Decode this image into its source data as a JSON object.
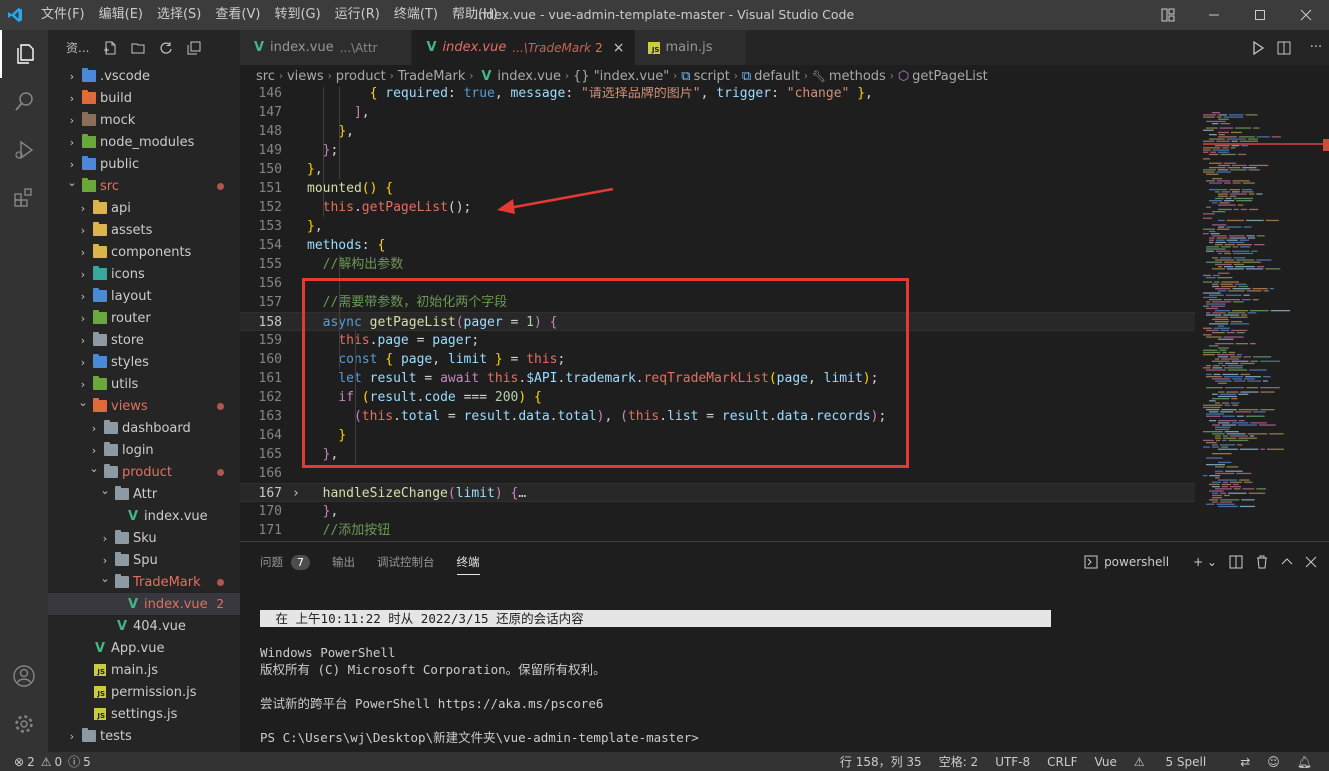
{
  "titlebar": {
    "menus": [
      "文件(F)",
      "编辑(E)",
      "选择(S)",
      "查看(V)",
      "转到(G)",
      "运行(R)",
      "终端(T)",
      "帮助(H)"
    ],
    "title": "index.vue - vue-admin-template-master - Visual Studio Code"
  },
  "sidebar": {
    "title": "资...",
    "items": [
      {
        "label": ".vscode",
        "type": "folder",
        "indent": 0,
        "chev": "›",
        "color": "#4b88d6"
      },
      {
        "label": "build",
        "type": "folder",
        "indent": 0,
        "chev": "›",
        "color": "#e06a3a"
      },
      {
        "label": "mock",
        "type": "folder",
        "indent": 0,
        "chev": "›",
        "color": "#8a7058"
      },
      {
        "label": "node_modules",
        "type": "folder",
        "indent": 0,
        "chev": "›",
        "color": "#6ba83b"
      },
      {
        "label": "public",
        "type": "folder",
        "indent": 0,
        "chev": "›",
        "color": "#4b88d6"
      },
      {
        "label": "src",
        "type": "folder",
        "indent": 0,
        "chev": "⌄",
        "color": "#6ba83b",
        "red": true,
        "dot": true
      },
      {
        "label": "api",
        "type": "folder",
        "indent": 1,
        "chev": "›",
        "color": "#dbb44a"
      },
      {
        "label": "assets",
        "type": "folder",
        "indent": 1,
        "chev": "›",
        "color": "#dbb44a"
      },
      {
        "label": "components",
        "type": "folder",
        "indent": 1,
        "chev": "›",
        "color": "#dbb44a"
      },
      {
        "label": "icons",
        "type": "folder",
        "indent": 1,
        "chev": "›",
        "color": "#38a89d"
      },
      {
        "label": "layout",
        "type": "folder",
        "indent": 1,
        "chev": "›",
        "color": "#4b88d6"
      },
      {
        "label": "router",
        "type": "folder",
        "indent": 1,
        "chev": "›",
        "color": "#6ba83b"
      },
      {
        "label": "store",
        "type": "folder",
        "indent": 1,
        "chev": "›",
        "color": "#8d9aa3"
      },
      {
        "label": "styles",
        "type": "folder",
        "indent": 1,
        "chev": "›",
        "color": "#4b88d6"
      },
      {
        "label": "utils",
        "type": "folder",
        "indent": 1,
        "chev": "›",
        "color": "#6ba83b"
      },
      {
        "label": "views",
        "type": "folder",
        "indent": 1,
        "chev": "⌄",
        "color": "#e06a3a",
        "red": true,
        "dot": true
      },
      {
        "label": "dashboard",
        "type": "folder",
        "indent": 2,
        "chev": "›",
        "color": "#8d9aa3"
      },
      {
        "label": "login",
        "type": "folder",
        "indent": 2,
        "chev": "›",
        "color": "#8d9aa3"
      },
      {
        "label": "product",
        "type": "folder",
        "indent": 2,
        "chev": "⌄",
        "color": "#8d9aa3",
        "red": true,
        "dot": true
      },
      {
        "label": "Attr",
        "type": "folder",
        "indent": 3,
        "chev": "⌄",
        "color": "#8d9aa3"
      },
      {
        "label": "index.vue",
        "type": "vue",
        "indent": 4,
        "chev": ""
      },
      {
        "label": "Sku",
        "type": "folder",
        "indent": 3,
        "chev": "›",
        "color": "#8d9aa3"
      },
      {
        "label": "Spu",
        "type": "folder",
        "indent": 3,
        "chev": "›",
        "color": "#8d9aa3"
      },
      {
        "label": "TradeMark",
        "type": "folder",
        "indent": 3,
        "chev": "⌄",
        "color": "#8d9aa3",
        "red": true,
        "dot": true
      },
      {
        "label": "index.vue",
        "type": "vue",
        "indent": 4,
        "chev": "",
        "red": true,
        "sel": true,
        "count": "2"
      },
      {
        "label": "404.vue",
        "type": "vue",
        "indent": 3,
        "chev": ""
      },
      {
        "label": "App.vue",
        "type": "vue",
        "indent": 1,
        "chev": ""
      },
      {
        "label": "main.js",
        "type": "js",
        "indent": 1,
        "chev": ""
      },
      {
        "label": "permission.js",
        "type": "js",
        "indent": 1,
        "chev": ""
      },
      {
        "label": "settings.js",
        "type": "js",
        "indent": 1,
        "chev": ""
      },
      {
        "label": "tests",
        "type": "folder",
        "indent": 0,
        "chev": "›",
        "color": "#8d9aa3"
      }
    ]
  },
  "tabs": [
    {
      "label": "index.vue",
      "desc": "...\\Attr",
      "icon": "vue",
      "active": false
    },
    {
      "label": "index.vue",
      "desc": "...\\TradeMark",
      "num": "2",
      "icon": "vue",
      "active": true
    },
    {
      "label": "main.js",
      "desc": "",
      "icon": "js",
      "active": false
    }
  ],
  "breadcrumbs": [
    "src",
    "views",
    "product",
    "TradeMark",
    "index.vue",
    "{} \"index.vue\"",
    "script",
    "default",
    "methods",
    "getPageList"
  ],
  "code": [
    {
      "ln": "146",
      "html": "        <span class='y'>{</span> <span class='v'>required</span><span class='p'>:</span> <span class='k'>true</span><span class='p'>,</span> <span class='v'>message</span><span class='p'>:</span> <span class='s'>\"请选择品牌的图片\"</span><span class='p'>,</span> <span class='v'>trigger</span><span class='p'>:</span> <span class='s'>\"change\"</span> <span class='y'>}</span><span class='p'>,</span>"
    },
    {
      "ln": "147",
      "html": "      <span class='kc'>]</span><span class='p'>,</span>"
    },
    {
      "ln": "148",
      "html": "    <span class='y'>}</span><span class='p'>,</span>"
    },
    {
      "ln": "149",
      "html": "  <span class='kc'>}</span><span class='p'>;</span>"
    },
    {
      "ln": "150",
      "html": "<span class='y'>}</span><span class='p'>,</span>"
    },
    {
      "ln": "151",
      "html": "<span class='f'>mounted</span><span class='y'>()</span> <span class='y'>{</span>"
    },
    {
      "ln": "152",
      "html": "  <span class='e'>this</span><span class='p'>.</span><span class='e'>getPageList</span><span class='p'>();</span>"
    },
    {
      "ln": "153",
      "html": "<span class='y'>}</span><span class='p'>,</span>"
    },
    {
      "ln": "154",
      "html": "<span class='v'>methods</span><span class='p'>:</span> <span class='y'>{</span>"
    },
    {
      "ln": "155",
      "html": "  <span class='c'>//解构出参数</span>"
    },
    {
      "ln": "156",
      "html": ""
    },
    {
      "ln": "157",
      "html": "  <span class='c'>//需要带参数，初始化两个字段</span>"
    },
    {
      "ln": "158",
      "html": "  <span class='k'>async</span> <span class='f'>getPageList</span><span class='kc'>(</span><span class='v'>pager</span> <span class='p'>=</span> <span class='n'>1</span><span class='kc'>)</span> <span class='kc'>{</span>",
      "cur": true
    },
    {
      "ln": "159",
      "html": "    <span class='e'>this</span><span class='p'>.</span><span class='v'>page</span> <span class='p'>=</span> <span class='v'>pager</span><span class='p'>;</span>"
    },
    {
      "ln": "160",
      "html": "    <span class='k'>const</span> <span class='y'>{</span> <span class='v'>page</span><span class='p'>,</span> <span class='v'>limit</span> <span class='y'>}</span> <span class='p'>=</span> <span class='e'>this</span><span class='p'>;</span>"
    },
    {
      "ln": "161",
      "html": "    <span class='k'>let</span> <span class='v'>result</span> <span class='p'>=</span> <span class='kc'>await</span> <span class='e'>this</span><span class='p'>.</span><span class='v'>$API</span><span class='p'>.</span><span class='v'>trademark</span><span class='p'>.</span><span class='e'>reqTradeMarkList</span><span class='y'>(</span><span class='v'>page</span><span class='p'>,</span> <span class='v'>limit</span><span class='y'>)</span><span class='p'>;</span>"
    },
    {
      "ln": "162",
      "html": "    <span class='kc'>if</span> <span class='y'>(</span><span class='v'>result</span><span class='p'>.</span><span class='v'>code</span> <span class='p'>===</span> <span class='n'>200</span><span class='y'>)</span> <span class='y'>{</span>"
    },
    {
      "ln": "163",
      "html": "      <span class='kc'>(</span><span class='e'>this</span><span class='p'>.</span><span class='v'>total</span> <span class='p'>=</span> <span class='v'>result</span><span class='p'>.</span><span class='v'>data</span><span class='p'>.</span><span class='v'>total</span><span class='kc'>)</span><span class='p'>,</span> <span class='kc'>(</span><span class='e'>this</span><span class='p'>.</span><span class='v'>list</span> <span class='p'>=</span> <span class='v'>result</span><span class='p'>.</span><span class='v'>data</span><span class='p'>.</span><span class='v'>records</span><span class='kc'>)</span><span class='p'>;</span>"
    },
    {
      "ln": "164",
      "html": "    <span class='y'>}</span>"
    },
    {
      "ln": "165",
      "html": "  <span class='kc'>}</span><span class='p'>,</span>"
    },
    {
      "ln": "166",
      "html": ""
    },
    {
      "ln": "167",
      "html": "  <span class='f'>handleSizeChange</span><span class='kc'>(</span><span class='v'>limit</span><span class='kc'>)</span> <span class='kc'>{</span><span class='p'>…</span>",
      "fold": true,
      "cur2": true
    },
    {
      "ln": "170",
      "html": "  <span class='kc'>}</span><span class='p'>,</span>"
    },
    {
      "ln": "171",
      "html": "  <span class='c'>//添加按钮</span>"
    }
  ],
  "panel": {
    "tabs": [
      {
        "label": "问题",
        "badge": "7"
      },
      {
        "label": "输出"
      },
      {
        "label": "调试控制台"
      },
      {
        "label": "终端",
        "active": true
      }
    ],
    "shell": "powershell"
  },
  "terminal": {
    "restore": " 在 上午10:11:22 时从 2022/3/15 还原的会话内容",
    "lines": [
      "Windows PowerShell",
      "版权所有 (C) Microsoft Corporation。保留所有权利。",
      "",
      "尝试新的跨平台 PowerShell https://aka.ms/pscore6",
      "",
      "PS C:\\Users\\wj\\Desktop\\新建文件夹\\vue-admin-template-master>"
    ]
  },
  "status": {
    "errors": "2",
    "warnings": "0",
    "info": "5",
    "position": "行 158，列 35",
    "spaces": "空格: 2",
    "encoding": "UTF-8",
    "eol": "CRLF",
    "language": "Vue",
    "spell": "5 Spell"
  },
  "colors": {
    "accent": "#e27060",
    "annotation": "#e53935",
    "activityBar": "#333333",
    "sidebar": "#252526",
    "editor": "#1e1e1e"
  }
}
